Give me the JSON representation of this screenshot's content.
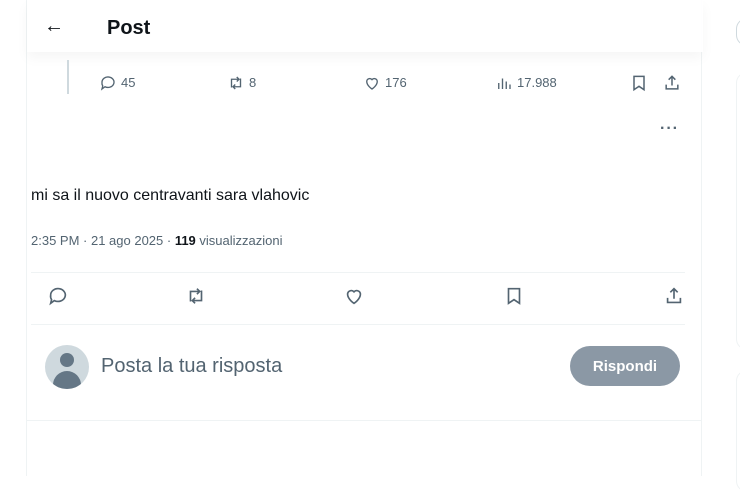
{
  "header": {
    "back_icon": "arrow-left-icon",
    "title": "Post"
  },
  "parent_tweet_metrics": {
    "replies": "45",
    "reposts": "8",
    "likes": "176",
    "views": "17.988"
  },
  "tweet": {
    "text": "mi sa il nuovo centravanti sara vlahovic",
    "time": "2:35 PM · 21 ago 2025 · ",
    "views_count": "119",
    "views_label": " visualizzazioni"
  },
  "reply": {
    "placeholder": "Posta la tua risposta",
    "button_label": "Rispondi"
  },
  "colors": {
    "muted": "#536471",
    "button_disabled": "#8b98a5",
    "border": "#eff3f4"
  }
}
